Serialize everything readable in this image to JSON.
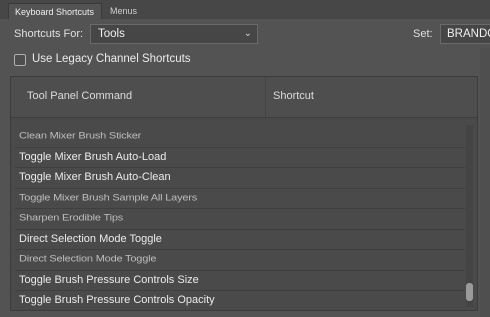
{
  "tabs": [
    "Keyboard Shortcuts",
    "Menus"
  ],
  "shortcuts_for_label": "Shortcuts For:",
  "shortcuts_for_value": "Tools",
  "set_label": "Set:",
  "set_value": "BRANDO",
  "legacy_checkbox": {
    "label": "Use Legacy Channel Shortcuts",
    "checked": false
  },
  "table": {
    "columns": [
      "Tool Panel Command",
      "Shortcut"
    ],
    "rows": [
      "Clean Mixer Brush Sticker",
      "Toggle Mixer Brush Auto-Load",
      "Toggle Mixer Brush Auto-Clean",
      "Toggle Mixer Brush Sample All Layers",
      "Sharpen Erodible Tips",
      "Direct Selection Mode Toggle",
      "Direct Selection Mode Toggle",
      "Toggle Brush Pressure Controls Size",
      "Toggle Brush Pressure Controls Opacity"
    ]
  }
}
